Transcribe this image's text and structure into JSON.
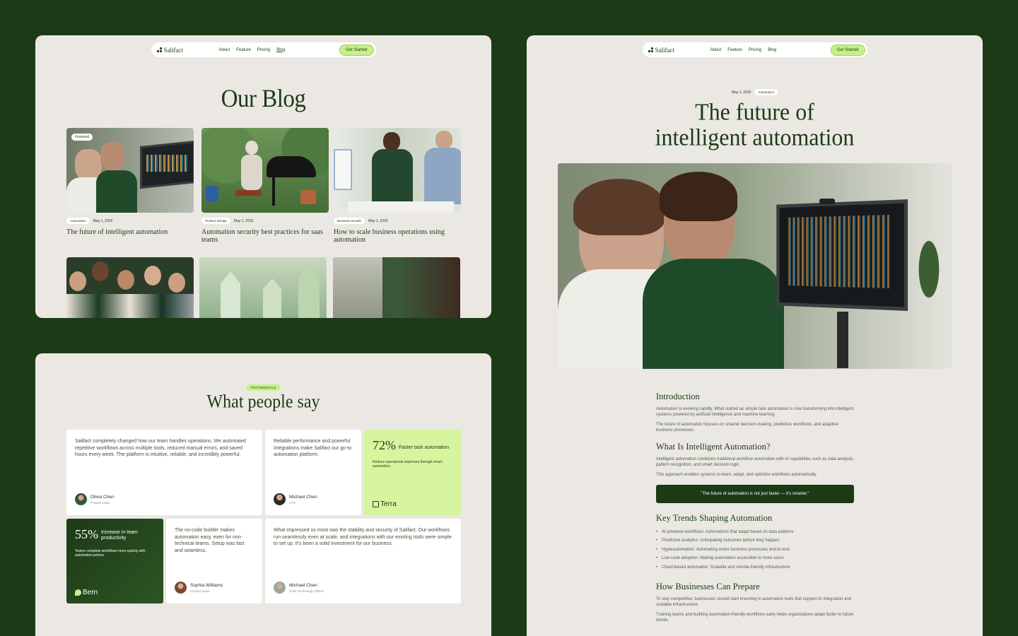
{
  "nav": {
    "brand": "Salifact",
    "links": [
      "About",
      "Feature",
      "Pricing",
      "Blog"
    ],
    "cta": "Get Started"
  },
  "blog": {
    "title": "Our Blog",
    "featured_badge": "Featured",
    "posts": [
      {
        "tag": "Automation",
        "date": "May 1, 2026",
        "title": "The future of intelligent automation"
      },
      {
        "tag": "Product Design",
        "date": "May 1, 2026",
        "title": "Automation security best practices for saas teams"
      },
      {
        "tag": "Business Growth",
        "date": "May 1, 2026",
        "title": "How to scale business operations using automation"
      }
    ]
  },
  "testimonials": {
    "pill": "TESTIMONIALS",
    "title": "What people say",
    "cards": [
      {
        "text": "Salifact completely changed how our team handles operations. We automated repetitive workflows across multiple tools, reduced manual errors, and saved hours every week. The platform is intuitive, reliable, and incredibly powerful.",
        "name": "Olivia Chen",
        "role": "Product Lead"
      },
      {
        "text": "Reliable performance and powerful integrations make Salifact our go-to automation platform.",
        "name": "Michael Chen",
        "role": "CTO"
      },
      {
        "text": "The no-code builder makes automation easy, even for non-technical teams. Setup was fast and seamless.",
        "name": "Sophia Williams",
        "role": "Product Lead"
      },
      {
        "text": "What impressed us most was the stability and security of Salifact. Our workflows run seamlessly even at scale, and integrations with our existing tools were simple to set up. It's been a solid investment for our business.",
        "name": "Michael Chen",
        "role": "Chief Technology Officer"
      }
    ],
    "stats": [
      {
        "value": "72%",
        "label": "Faster task automation",
        "sub": "Reduce operational expenses through smart automation.",
        "brand": "Terra",
        "bg": "#d6f59e"
      },
      {
        "value": "55%",
        "label": "Increase in team productivity",
        "sub": "Teams complete workflows more quickly with automated actions.",
        "brand": "Bern",
        "bg": "#1d3a16"
      }
    ]
  },
  "post": {
    "date": "May 1, 2026",
    "tag": "Automation",
    "title_line1": "The future of",
    "title_line2": "intelligent automation",
    "sections": {
      "intro_h": "Introduction",
      "intro_p1": "Automation is evolving rapidly. What started as simple task automation is now transforming into intelligent systems powered by artificial intelligence and machine learning.",
      "intro_p2": "The future of automation focuses on smarter decision-making, predictive workflows, and adaptive business processes.",
      "what_h": "What Is Intelligent Automation?",
      "what_p1": "Intelligent automation combines traditional workflow automation with AI capabilities such as data analysis, pattern recognition, and smart decision logic.",
      "what_p2": "This approach enables systems to learn, adapt, and optimize workflows automatically.",
      "quote": "\"The future of automation is not just faster — it's smarter.\"",
      "trends_h": "Key Trends Shaping Automation",
      "trends": [
        "AI-powered workflows: Automations that adapt based on data patterns",
        "Predictive analytics: Anticipating outcomes before they happen",
        "Hyperautomation: Automating entire business processes end-to-end",
        "Low-code adoption: Making automation accessible to more users",
        "Cloud-based automation: Scalable and remote-friendly infrastructure"
      ],
      "prepare_h": "How Businesses Can Prepare",
      "prepare_p1": "To stay competitive, businesses should start investing in automation tools that support AI integration and scalable infrastructure.",
      "prepare_p2": "Training teams and building automation-friendly workflows early helps organizations adapt faster to future trends."
    }
  },
  "colors": {
    "bg": "#1d3a16",
    "panel": "#ebe8e3",
    "accent": "#c6f089"
  }
}
